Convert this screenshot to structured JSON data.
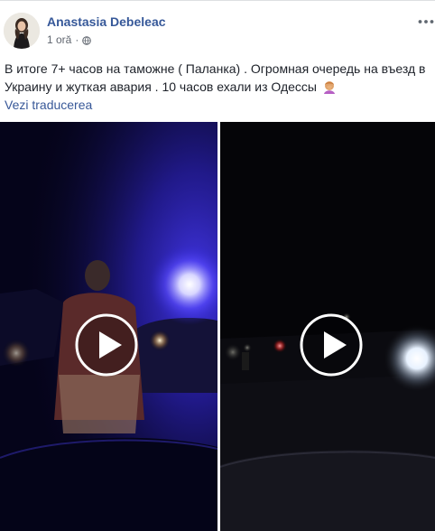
{
  "post": {
    "author": "Anastasia Debeleac",
    "timestamp": "1 oră",
    "separator": "·",
    "privacy_icon": "globe-icon",
    "more_icon": "ellipsis-icon",
    "text_line1": "В итоге 7+ часов на таможне ( Паланка) . Огромная очередь на въезд в",
    "text_line2": "Украину и жуткая авария . 10 часов ехали из Одессы",
    "emoji": "person-facepalming-emoji",
    "translate_link": "Vezi traducerea"
  },
  "media": [
    {
      "type": "video",
      "icon": "play-icon"
    },
    {
      "type": "video",
      "icon": "play-icon"
    }
  ],
  "colors": {
    "link": "#365899",
    "text": "#1d2129",
    "meta": "#616770",
    "police_blue": "#2a22c8"
  }
}
